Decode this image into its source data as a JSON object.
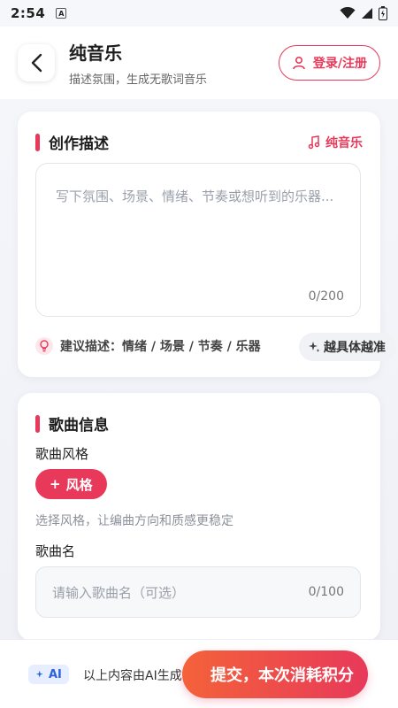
{
  "status": {
    "time": "2:54",
    "badge": "A"
  },
  "header": {
    "title": "纯音乐",
    "subtitle": "描述氛围，生成无歌词音乐",
    "login_label": "登录/注册"
  },
  "creation": {
    "title": "创作描述",
    "mode_label": "纯音乐",
    "placeholder": "写下氛围、场景、情绪、节奏或想听到的乐器...",
    "counter": "0/200",
    "hint": "建议描述：情绪 / 场景 / 节奏 / 乐器",
    "hint_button": "越具体越准"
  },
  "song_info": {
    "title": "歌曲信息",
    "style_label": "歌曲风格",
    "style_chip": "风格",
    "style_hint": "选择风格，让编曲方向和质感更稳定",
    "name_label": "歌曲名",
    "name_placeholder": "请输入歌曲名（可选）",
    "name_counter": "0/100"
  },
  "footer": {
    "ai_badge": "AI",
    "note": "以上内容由AI生成",
    "submit_label": "提交，本次消耗积分"
  },
  "colors": {
    "accent": "#e8395a",
    "accent_orange": "#f4623a",
    "ai_blue": "#2c63d8"
  }
}
